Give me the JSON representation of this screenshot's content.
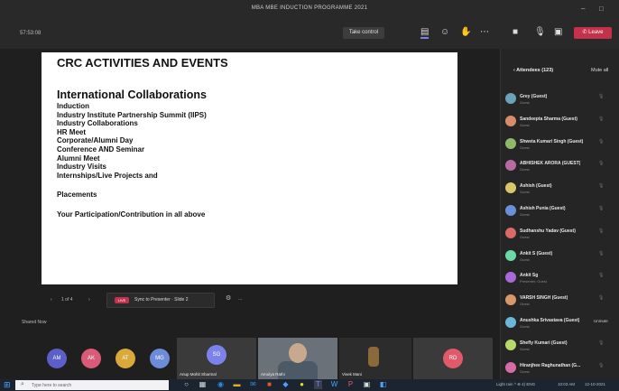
{
  "window": {
    "title": "MBA MBE INDUCTION PROGRAMME 2021"
  },
  "window_controls": {
    "minimize": "–",
    "maximize": "□"
  },
  "toolbar": {
    "timer": "57:53:08",
    "take_control": "Take control",
    "leave": "Leave"
  },
  "slide": {
    "title": "CRC ACTIVITIES AND EVENTS",
    "section": "International Collaborations",
    "items": [
      "Induction",
      "Industry Institute Partnership Summit   (IIPS)",
      "Industry Collaborations",
      "HR Meet",
      "Corporate/Alumni Day",
      "Conference AND Seminar",
      "Alumni Meet",
      "Industry Visits",
      "Internships/Live Projects    and"
    ],
    "placements": "Placements",
    "footer": "Your Participation/Contribution  in all above"
  },
  "slide_controls": {
    "prev": "‹",
    "page": "1 of 4",
    "next": "›",
    "badge": "LIVE",
    "pill_text": "Sync to Presenter · Slide 2",
    "more": "⋯"
  },
  "shared_by": "Shared Now",
  "strip": {
    "avatars": [
      {
        "initials": "AM",
        "color": "#5b5fc7"
      },
      {
        "initials": "AK",
        "color": "#d95b7a"
      },
      {
        "initials": "AT",
        "color": "#d9a93a"
      },
      {
        "initials": "MG",
        "color": "#6e8bd8"
      }
    ],
    "tiles": [
      {
        "name": "Anup Mohit Sharmal",
        "initials": "SG",
        "color": "#7b83eb"
      },
      {
        "name": "Amulya Rathi"
      },
      {
        "name": "Vivek Mani"
      },
      {
        "name": "",
        "initials": "RD",
        "color": "#e05a6c"
      }
    ]
  },
  "panel": {
    "title": "‹ Attendees (123)",
    "admit_label": "Mute all"
  },
  "participants": [
    {
      "name": "Grey (Guest)",
      "role": "Guest",
      "color": "#6aa2b8"
    },
    {
      "name": "Sandeepta Sharma (Guest)",
      "role": "Guest",
      "color": "#d98c6c"
    },
    {
      "name": "Shweta Kumari Singh (Guest)",
      "role": "Guest",
      "color": "#8fb86a"
    },
    {
      "name": "ABHISHEK ARORA (GUEST)",
      "role": "Guest",
      "color": "#b86aa2"
    },
    {
      "name": "Ashish (Guest)",
      "role": "Guest",
      "color": "#d9c56a"
    },
    {
      "name": "Ashish Punia (Guest)",
      "role": "Guest",
      "color": "#6a8fd9"
    },
    {
      "name": "Sudhanshu Yadav (Guest)",
      "role": "Guest",
      "color": "#d96a6a"
    },
    {
      "name": "Ankit S (Guest)",
      "role": "Guest",
      "color": "#6ad9a8"
    },
    {
      "name": "Ankit Sg",
      "role": "Presenter, Guest",
      "color": "#a86ad9"
    },
    {
      "name": "VARSH SINGH (Guest)",
      "role": "Guest",
      "color": "#d9986a"
    },
    {
      "name": "Anushka Srivastava (Guest)",
      "role": "Guest",
      "color": "#6ab8d9",
      "tag": "Unmute"
    },
    {
      "name": "Shefly Kumari (Guest)",
      "role": "Guest",
      "color": "#b8d96a"
    },
    {
      "name": "Hiranjhee Raghunathan (G...",
      "role": "Guest",
      "color": "#d96aa8"
    }
  ],
  "taskbar": {
    "search_placeholder": "Type here to search",
    "tray": "Light rain  ^  ⊕ 4) ENG",
    "time": "10:03 AM",
    "date": "12-10-2021"
  },
  "colors": {
    "accent": "#7b83eb",
    "leave": "#c4314b",
    "panel_bg": "#252525"
  }
}
